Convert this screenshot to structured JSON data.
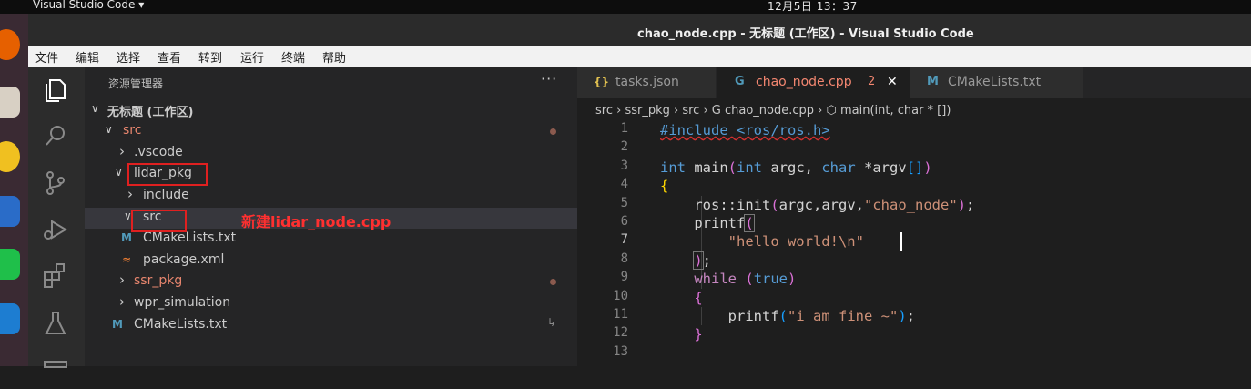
{
  "topbar": {
    "app": "Visual Studio Code ▾",
    "clock": "12月5日  13：37"
  },
  "window": {
    "title": "chao_node.cpp - 无标题 (工作区) - Visual Studio Code"
  },
  "menu": [
    "文件",
    "编辑",
    "选择",
    "查看",
    "转到",
    "运行",
    "终端",
    "帮助"
  ],
  "activity": [
    "files-icon",
    "search-icon",
    "source-control-icon",
    "run-debug-icon",
    "extensions-icon",
    "test-flask-icon"
  ],
  "explorer": {
    "title": "资源管理器",
    "more": "···",
    "tree": [
      {
        "label": "无标题 (工作区)",
        "twisty": "∨",
        "depth": 0
      },
      {
        "label": "src",
        "twisty": "∨",
        "depth": 1,
        "modified": true
      },
      {
        "label": ".vscode",
        "twisty": "›",
        "depth": 2
      },
      {
        "label": "lidar_pkg",
        "twisty": "∨",
        "depth": 2
      },
      {
        "label": "include",
        "twisty": "›",
        "depth": 3
      },
      {
        "label": "src",
        "twisty": "∨",
        "depth": 3,
        "selected": true
      },
      {
        "label": "CMakeLists.txt",
        "icon": "M",
        "depth": 2
      },
      {
        "label": "package.xml",
        "icon": "≈",
        "depth": 2
      },
      {
        "label": "ssr_pkg",
        "twisty": "›",
        "depth": 1,
        "modified": true
      },
      {
        "label": "wpr_simulation",
        "twisty": "›",
        "depth": 1
      },
      {
        "label": "CMakeLists.txt",
        "icon": "M",
        "depth": 0
      }
    ],
    "annotation": "新建lidar_node.cpp"
  },
  "tabs": [
    {
      "label": "tasks.json",
      "icon": "{}"
    },
    {
      "label": "chao_node.cpp",
      "icon": "G",
      "badge": "2",
      "active": true
    },
    {
      "label": "CMakeLists.txt",
      "icon": "M"
    }
  ],
  "breadcrumb": "src › ssr_pkg › src › G chao_node.cpp › ⬡ main(int, char * [])",
  "code": {
    "line_numbers": [
      "1",
      "2",
      "3",
      "4",
      "5",
      "6",
      "7",
      "8",
      "9",
      "10",
      "11",
      "12",
      "13"
    ],
    "lines": [
      "#include <ros/ros.h>",
      "",
      "int main(int argc, char *argv[])",
      "{",
      "    ros::init(argc,argv,\"chao_node\");",
      "    printf(",
      "        \"hello world!\\n\"",
      "    );",
      "    while (true)",
      "    {",
      "        printf(\"i am fine ~\");",
      "    }",
      ""
    ]
  },
  "colors": {
    "keyword": "#569cd6",
    "string": "#ce9178",
    "bracket_yellow": "#ffd700",
    "bracket_pink": "#da70d6",
    "annotation": "#ff3030"
  }
}
